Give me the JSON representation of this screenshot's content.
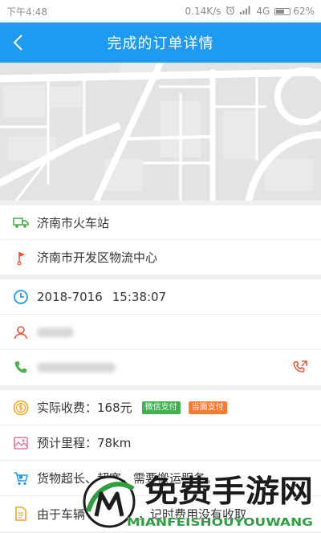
{
  "status_bar": {
    "time": "下午4:48",
    "net_speed": "0.14K/s",
    "network": "4G",
    "battery": "62%",
    "battery_level": 0.62,
    "icons": [
      "alarm-icon",
      "signal-icon",
      "battery-icon"
    ]
  },
  "header": {
    "title": "完成的订单详情",
    "back_icon": "chevron-left-icon"
  },
  "colors": {
    "primary": "#1E9BF0",
    "green": "#4CAF50",
    "red": "#E8553A",
    "orange": "#F5A623",
    "pink": "#E5739A",
    "badge_wechat": "#3FB24F",
    "badge_cash": "#FF7A2F"
  },
  "order": {
    "origin": {
      "icon": "truck-icon",
      "text": "济南市火车站"
    },
    "destination": {
      "icon": "flag-icon",
      "text": "济南市开发区物流中心"
    },
    "time": {
      "icon": "clock-icon",
      "date": "2018-7016",
      "clock": "15:38:07"
    },
    "contact": {
      "icon": "person-icon"
    },
    "phone": {
      "icon": "phone-icon",
      "call_icon": "call-outgoing-icon"
    },
    "fee": {
      "icon": "coin-icon",
      "text": "实际收费：168元",
      "badges": [
        "微信支付",
        "当面支付"
      ]
    },
    "distance": {
      "icon": "map-icon",
      "text": "预计里程：78km"
    },
    "cargo": {
      "icon": "cart-icon",
      "text": "货物超长、超宽，需要搬运服务。"
    },
    "note": {
      "icon": "document-icon",
      "text_start": "由于车辆",
      "text_end": "，记时费用没有收取"
    }
  },
  "watermark": {
    "title": "免费手游网",
    "subtitle": "MIANFEISHOUYOUWANG",
    "logo_letter": "M"
  }
}
